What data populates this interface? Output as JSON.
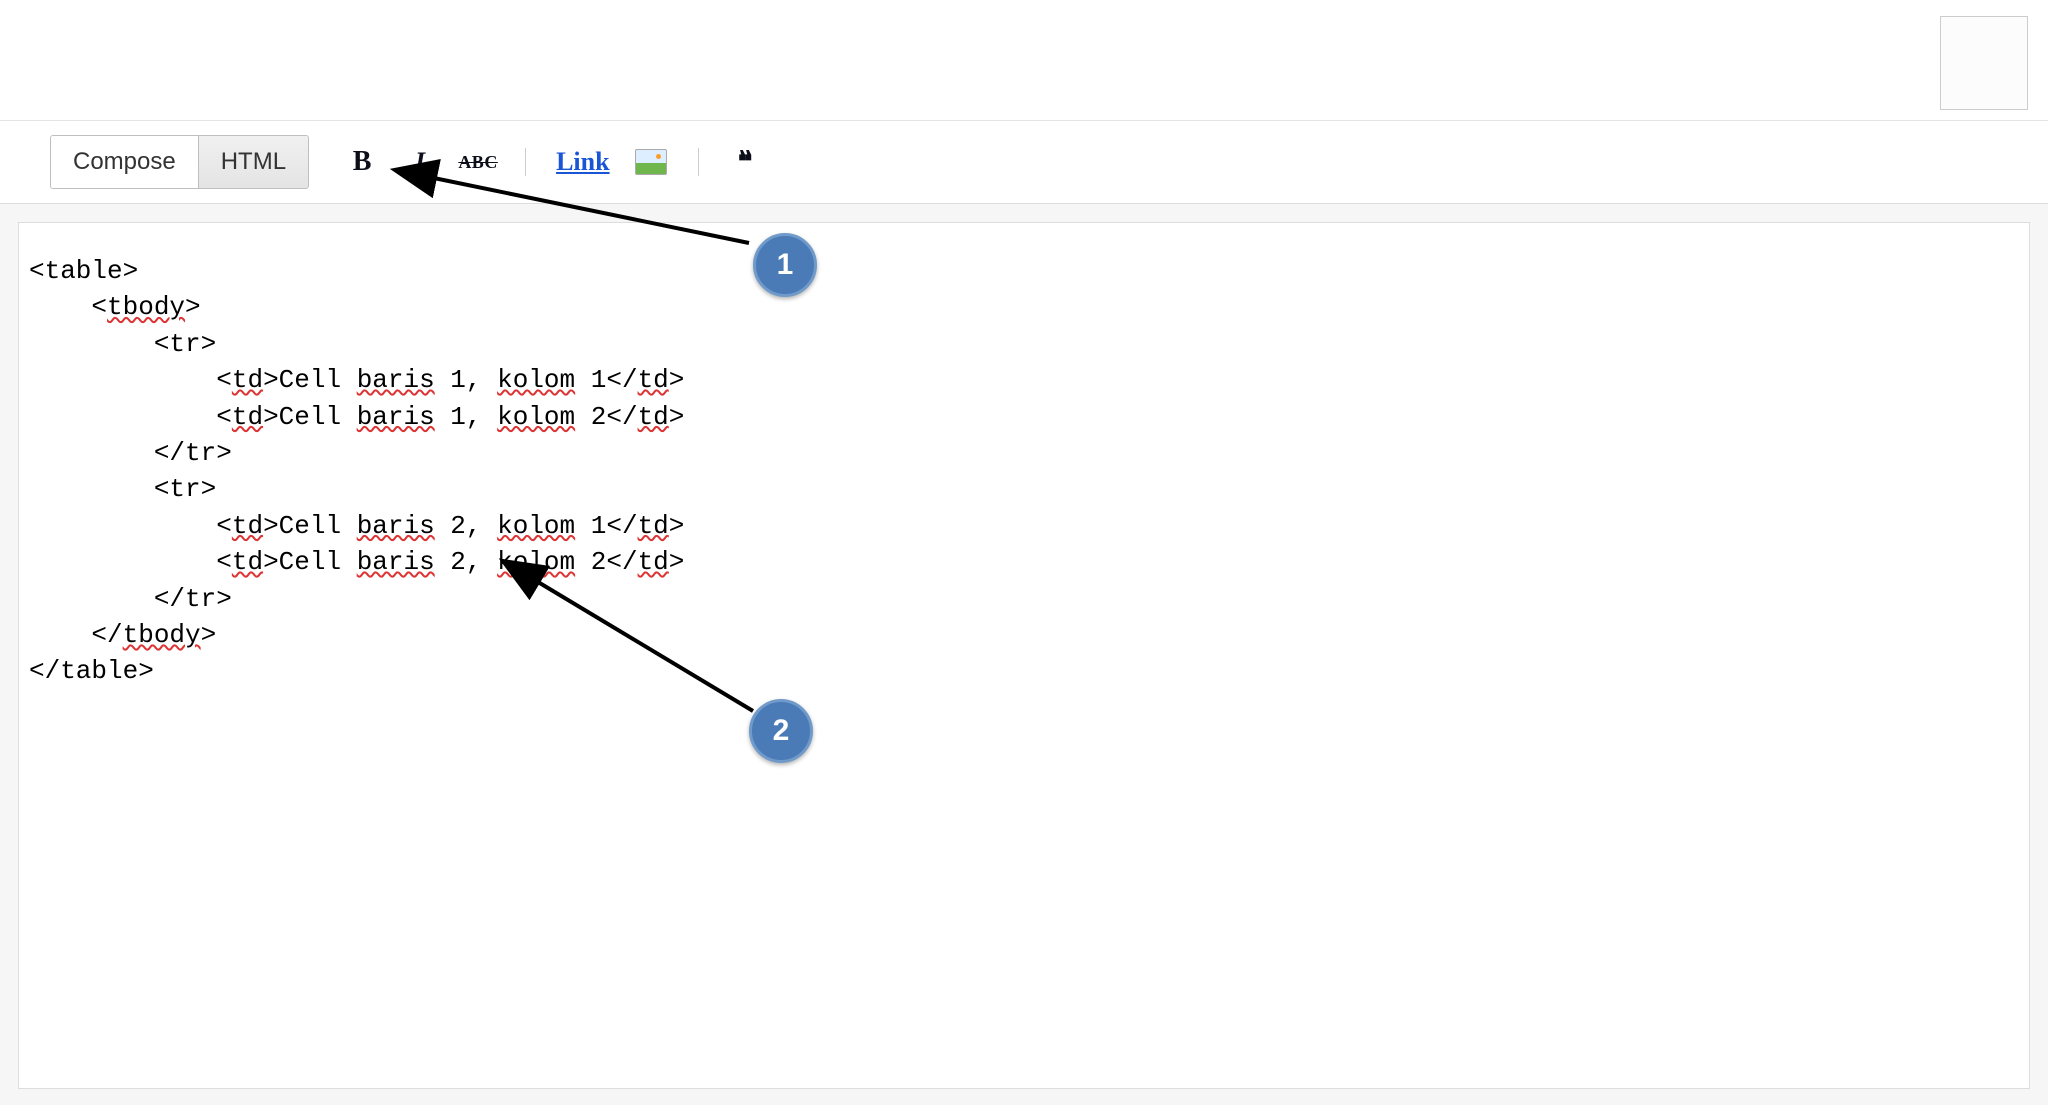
{
  "toolbar": {
    "compose_label": "Compose",
    "html_label": "HTML",
    "bold_glyph": "B",
    "italic_glyph": "I",
    "strike_glyph": "ABC",
    "link_label": "Link",
    "quote_glyph": "❝"
  },
  "editor": {
    "code_lines": [
      "<table>",
      "    <tbody>",
      "        <tr>",
      "            <td>Cell baris 1, kolom 1</td>",
      "            <td>Cell baris 1, kolom 2</td>",
      "        </tr>",
      "        <tr>",
      "            <td>Cell baris 2, kolom 1</td>",
      "            <td>Cell baris 2, kolom 2</td>",
      "        </tr>",
      "    </tbody>",
      "</table>"
    ]
  },
  "callouts": {
    "one": "1",
    "two": "2"
  }
}
